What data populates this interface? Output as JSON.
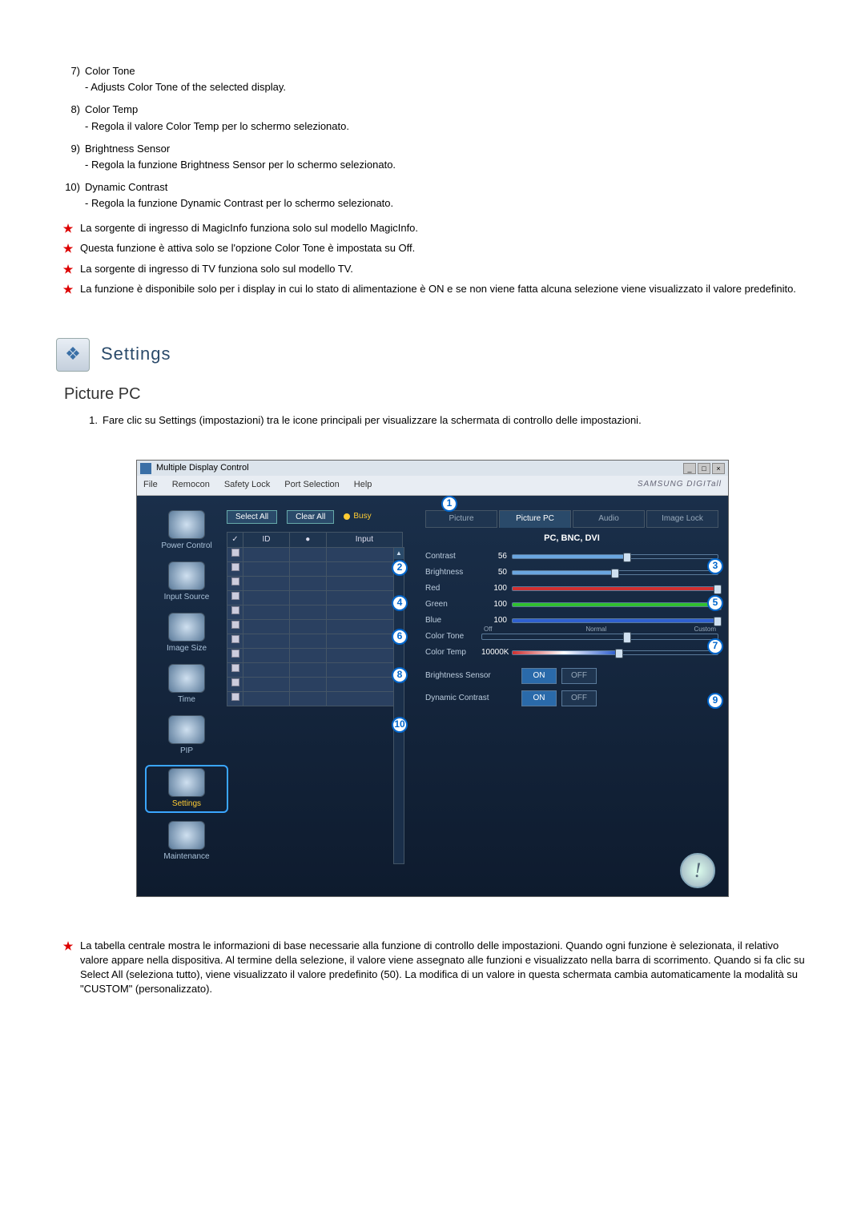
{
  "list_items": [
    {
      "num": "7)",
      "title": "Color Tone",
      "desc": "- Adjusts Color Tone of the selected display."
    },
    {
      "num": "8)",
      "title": "Color Temp",
      "desc": "- Regola il valore Color Temp per lo schermo selezionato."
    },
    {
      "num": "9)",
      "title": "Brightness Sensor",
      "desc": "- Regola la funzione Brightness Sensor per lo schermo selezionato."
    },
    {
      "num": "10)",
      "title": "Dynamic Contrast",
      "desc": "- Regola la funzione Dynamic Contrast per lo schermo selezionato."
    }
  ],
  "star_notes_top": [
    "La sorgente di ingresso di MagicInfo funziona solo sul modello MagicInfo.",
    "Questa funzione è attiva solo se l'opzione Color Tone è impostata su Off.",
    "La sorgente di ingresso di TV funziona solo sul modello TV.",
    "La funzione è disponibile solo per i display in cui lo stato di alimentazione è ON e se non viene fatta alcuna selezione viene visualizzato il valore predefinito."
  ],
  "section_heading": "Settings",
  "sub_heading": "Picture PC",
  "step1_num": "1.",
  "step1_text": "Fare clic su Settings (impostazioni) tra le icone principali per visualizzare la schermata di controllo delle impostazioni.",
  "window": {
    "title": "Multiple Display Control",
    "menu": [
      "File",
      "Remocon",
      "Safety Lock",
      "Port Selection",
      "Help"
    ],
    "brand": "SAMSUNG DIGITall",
    "sidebar": [
      {
        "label": "Power Control"
      },
      {
        "label": "Input Source"
      },
      {
        "label": "Image Size"
      },
      {
        "label": "Time"
      },
      {
        "label": "PIP"
      },
      {
        "label": "Settings",
        "selected": true
      },
      {
        "label": "Maintenance"
      }
    ],
    "select_all": "Select All",
    "clear_all": "Clear All",
    "busy": "Busy",
    "table_headers": {
      "chk": "✓",
      "id": "ID",
      "stat": "●",
      "input": "Input"
    },
    "row_count": 11,
    "tabs": [
      "Picture",
      "Picture PC",
      "Audio",
      "Image Lock"
    ],
    "active_tab": "Picture PC",
    "mode": "PC, BNC, DVI",
    "sliders": [
      {
        "label": "Contrast",
        "value": "56",
        "fill": "#6aa6e0",
        "pct": 56
      },
      {
        "label": "Brightness",
        "value": "50",
        "fill": "#6aa6e0",
        "pct": 50
      },
      {
        "label": "Red",
        "value": "100",
        "fill": "#d03030",
        "pct": 100
      },
      {
        "label": "Green",
        "value": "100",
        "fill": "#30c030",
        "pct": 100
      },
      {
        "label": "Blue",
        "value": "100",
        "fill": "#3060d0",
        "pct": 100
      }
    ],
    "color_tone": {
      "label": "Color Tone",
      "options": [
        "Off",
        "Normal",
        "Custom"
      ],
      "pos": 60
    },
    "color_temp": {
      "label": "Color Temp",
      "value": "10000K",
      "pct": 50
    },
    "brightness_sensor": {
      "label": "Brightness Sensor",
      "on": "ON",
      "off": "OFF"
    },
    "dynamic_contrast": {
      "label": "Dynamic Contrast",
      "on": "ON",
      "off": "OFF"
    },
    "callouts": {
      "1": "1",
      "2": "2",
      "3": "3",
      "4": "4",
      "5": "5",
      "6": "6",
      "7": "7",
      "8": "8",
      "9": "9",
      "10": "10"
    }
  },
  "star_notes_bottom": [
    "La tabella centrale mostra le informazioni di base necessarie alla funzione di controllo delle impostazioni. Quando ogni funzione è selezionata, il relativo valore appare nella dispositiva. Al termine della selezione, il valore viene assegnato alle funzioni e visualizzato nella barra di scorrimento. Quando si fa clic su Select All (seleziona tutto), viene visualizzato il valore predefinito (50). La modifica di un valore in questa schermata cambia automaticamente la modalità su \"CUSTOM\" (personalizzato)."
  ]
}
